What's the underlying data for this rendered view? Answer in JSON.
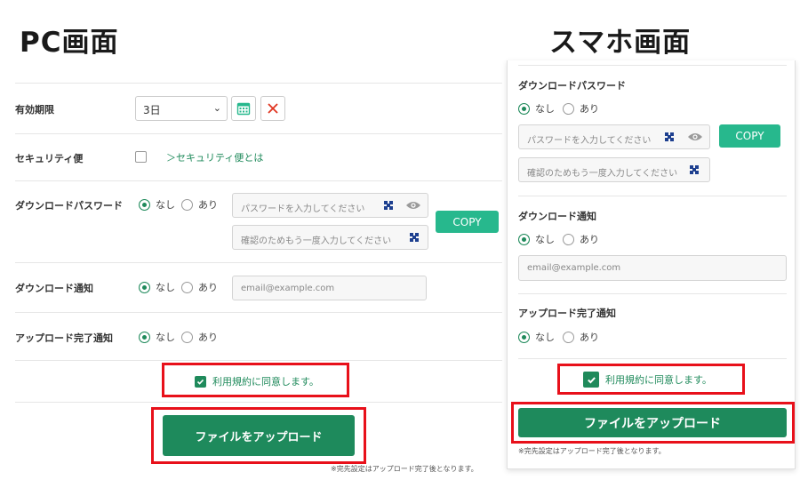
{
  "headings": {
    "pc": "PC画面",
    "smartphone": "スマホ画面"
  },
  "form": {
    "expiry": {
      "label": "有効期限",
      "value": "3日"
    },
    "security_mail": {
      "label": "セキュリティ便",
      "link": "＞セキュリティ便とは"
    },
    "download_password": {
      "label": "ダウンロードパスワード",
      "option_none": "なし",
      "option_yes": "あり",
      "selected": "なし",
      "password_placeholder": "パスワードを入力してください",
      "confirm_placeholder": "確認のためもう一度入力してください",
      "copy_label": "COPY"
    },
    "download_notice": {
      "label": "ダウンロード通知",
      "option_none": "なし",
      "option_yes": "あり",
      "selected": "なし",
      "email_placeholder": "email@example.com"
    },
    "upload_notice": {
      "label": "アップロード完了通知",
      "option_none": "なし",
      "option_yes": "あり",
      "selected": "なし"
    },
    "agree_label": "利用規約に同意します。",
    "agree_checked": true,
    "upload_button": "ファイルをアップロード",
    "note": "※完先設定はアップロード完了後となります。"
  },
  "colors": {
    "accent": "#1e8a5c",
    "copy": "#27b88d",
    "highlight": "#e8101a",
    "delete": "#e0341f"
  },
  "icons": [
    "calendar-icon",
    "close-icon",
    "key-icon",
    "eye-icon",
    "check-icon",
    "chevron-down-icon"
  ]
}
